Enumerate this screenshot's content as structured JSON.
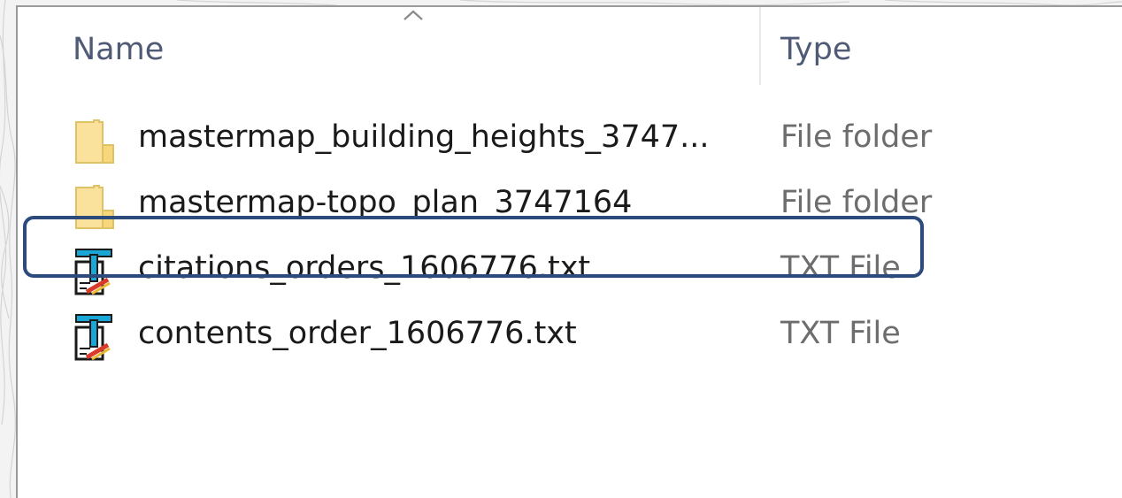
{
  "columns": {
    "name_label": "Name",
    "type_label": "Type",
    "sort_icon": "chevron-up-icon"
  },
  "files": [
    {
      "name": "mastermap_building_heights_3747...",
      "type": "File folder",
      "icon": "folder-icon"
    },
    {
      "name": "mastermap-topo_plan_3747164",
      "type": "File folder",
      "icon": "folder-icon"
    },
    {
      "name": "citations_orders_1606776.txt",
      "type": "TXT File",
      "icon": "text-file-icon"
    },
    {
      "name": "contents_order_1606776.txt",
      "type": "TXT File",
      "icon": "text-file-icon"
    }
  ],
  "colors": {
    "header_text": "#4f5b76",
    "highlight_border": "#2c4a7c",
    "folder_fill": "#fbe29c",
    "folder_edge": "#e0c266"
  }
}
